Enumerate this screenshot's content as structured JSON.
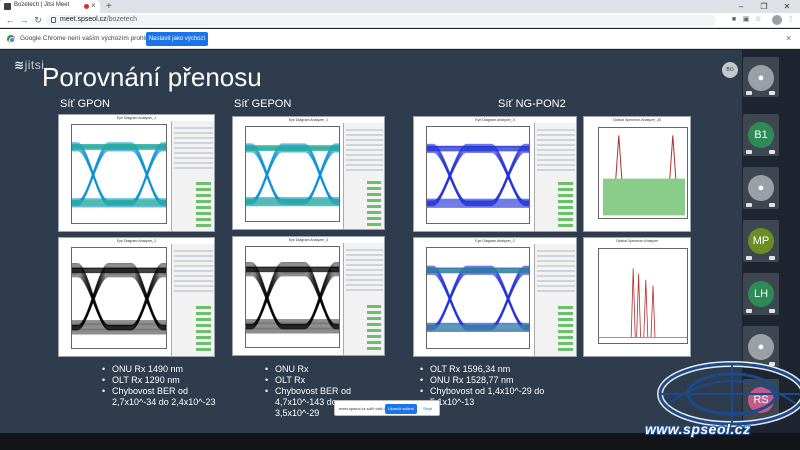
{
  "browser": {
    "tab_title": "Bozetech | Jitsi Meet",
    "tab_close": "×",
    "new_tab": "+",
    "url_host": "meet.spseol.cz",
    "url_path": "/bozetech",
    "win_min": "–",
    "win_max": "❐",
    "win_close": "✕",
    "infobar_text": "Google Chrome není vaším výchozím prohlížečem",
    "infobar_button": "Nastavit jako výchozí",
    "infobar_close": "×"
  },
  "meeting": {
    "logo_prefix": "jits",
    "logo_suffix": "i",
    "self_avatar": "BO",
    "participants": [
      {
        "initials": "",
        "color": "#9aa0a6",
        "kind": "camera"
      },
      {
        "initials": "B1",
        "color": "#2e8b57",
        "kind": "initials"
      },
      {
        "initials": "",
        "color": "#9aa0a6",
        "kind": "person"
      },
      {
        "initials": "MP",
        "color": "#6b8e23",
        "kind": "initials"
      },
      {
        "initials": "LH",
        "color": "#2e8b57",
        "kind": "initials"
      },
      {
        "initials": "",
        "color": "#9aa0a6",
        "kind": "person"
      },
      {
        "initials": "RS",
        "color": "#c25a8a",
        "kind": "initials"
      }
    ],
    "share_text": "meet.spseol.cz sdílí vaši obrazovku.",
    "share_button": "Ukončit sdílení",
    "share_hide": "Skrýt"
  },
  "slide": {
    "title": "Porovnání přenosu",
    "sections": {
      "gpon": "Síť GPON",
      "gepon": "Síť GEPON",
      "ngpon2": "Síť NG-PON2"
    },
    "screens": {
      "eye_title_1": "Eye Diagram Analyzer_1",
      "eye_title_2": "Eye Diagram Analyzer_2",
      "eye_title_3": "Eye Diagram Analyzer_3",
      "eye_title_4": "Eye Diagram Analyzer_4",
      "osa_title_1": "Optical Spectrum Analyzer_20",
      "osa_title_2": "Optical Spectrum Analyzer"
    },
    "bullets_gpon": [
      "ONU Rx 1490 nm",
      "OLT Rx 1290 nm",
      "Chybovost BER od 2,7x10^-34 do 2,4x10^-23"
    ],
    "bullets_gepon": [
      "ONU Rx",
      "OLT Rx",
      "Chybovost BER od 4,7x10^-143 do 3,5x10^-29"
    ],
    "bullets_ngpon2": [
      "OLT Rx 1596,34 nm",
      "ONU Rx 1528,77 nm",
      "Chybovost od 1,4x10^-29 do 5,1x10^-13"
    ]
  },
  "watermark": {
    "text": "www.spseol.cz"
  },
  "colors": {
    "slide_bg": "#2f3c4e",
    "accent_blue": "#1a73e8",
    "eye_color_1": "#0a8fd6",
    "eye_color_2": "#000000",
    "eye_color_3": "#1f2fd9",
    "spectrum_red": "#b03030",
    "spectrum_green": "#6dbf6d"
  }
}
